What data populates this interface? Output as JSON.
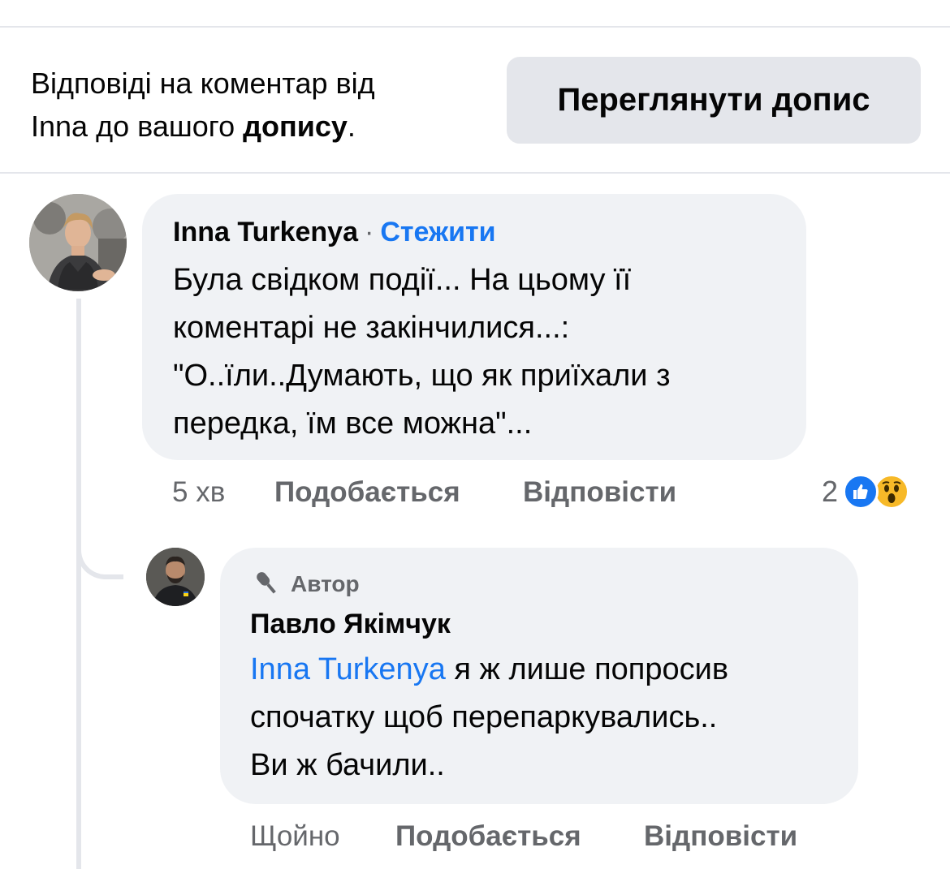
{
  "header": {
    "notice_line1": "Відповіді на коментар від",
    "notice_line2_prefix": "Inna до вашого ",
    "notice_line2_bold": "допису",
    "notice_line2_suffix": ".",
    "view_post_button": "Переглянути допис"
  },
  "comment": {
    "author": "Inna Turkenya",
    "separator": "·",
    "follow_label": "Стежити",
    "text_lines": [
      "Була свідком події... На цьому її",
      "коментарі не закінчилися...:",
      "\"О..їли..Думають, що як приїхали з",
      "передка, їм все можна\"..."
    ],
    "time": "5 хв",
    "like_label": "Подобається",
    "reply_label": "Відповісти",
    "reaction_count": "2",
    "reactions": [
      "like-icon",
      "wow-icon"
    ]
  },
  "reply": {
    "badge_label": "Автор",
    "badge_icon": "microphone-icon",
    "author": "Павло Якімчук",
    "mention": "Inna Turkenya",
    "text_first": " я ж лише попросив",
    "text_lines": [
      "спочатку щоб перепаркувались..",
      "Ви ж бачили.."
    ],
    "time": "Щойно",
    "like_label": "Подобається",
    "reply_label": "Відповісти"
  },
  "colors": {
    "accent": "#1877f2",
    "bubble": "#f0f2f5",
    "button": "#e4e6eb",
    "secondary_text": "#65676b",
    "wow": "#f7b928"
  }
}
